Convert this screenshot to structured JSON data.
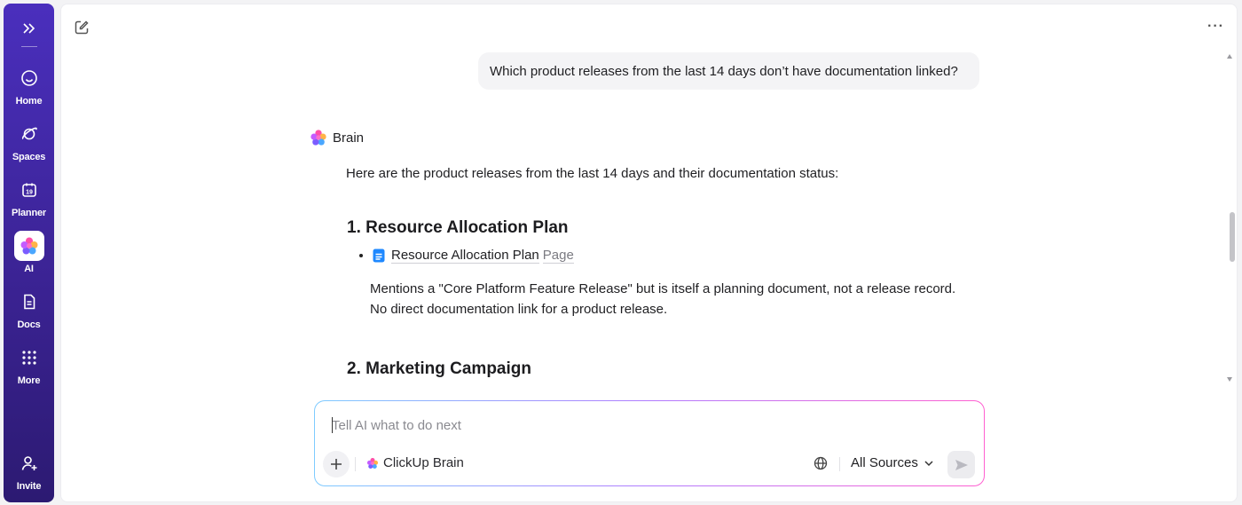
{
  "sidebar": {
    "expand_icon": "double-chevron-right-icon",
    "items": [
      {
        "label": "Home",
        "icon": "home-icon"
      },
      {
        "label": "Spaces",
        "icon": "planet-icon"
      },
      {
        "label": "Planner",
        "icon": "calendar-icon",
        "date": "19"
      },
      {
        "label": "AI",
        "icon": "ai-brain-icon",
        "active": true
      },
      {
        "label": "Docs",
        "icon": "doc-icon"
      },
      {
        "label": "More",
        "icon": "grid-dots-icon"
      }
    ],
    "invite": {
      "label": "Invite",
      "icon": "add-user-icon"
    }
  },
  "header": {
    "new_chat_icon": "new-chat-icon",
    "more_icon": "more-horizontal-icon"
  },
  "conversation": {
    "user_message": "Which product releases from the last 14 days don’t have documentation linked?",
    "assistant": {
      "name": "Brain",
      "intro": "Here are the product releases from the last 14 days and their documentation status:",
      "sections": [
        {
          "heading": "1. Resource Allocation Plan",
          "item_title": "Resource Allocation Plan",
          "item_type": "Page",
          "body_line1": "Mentions a \"Core Platform Feature Release\" but is itself a planning document, not a release record.",
          "body_line2": "No direct documentation link for a product release."
        },
        {
          "heading": "2. Marketing Campaign"
        }
      ]
    }
  },
  "composer": {
    "placeholder": "Tell AI what to do next",
    "model_label": "ClickUp Brain",
    "sources_label": "All Sources",
    "icons": [
      "plus-icon",
      "globe-icon",
      "chevron-down-icon",
      "send-icon"
    ]
  },
  "colors": {
    "sidebar_top": "#4a2fbd",
    "sidebar_bottom": "#2c1a72",
    "composer_border_start": "#7ecbff",
    "composer_border_end": "#ff5fd0"
  }
}
